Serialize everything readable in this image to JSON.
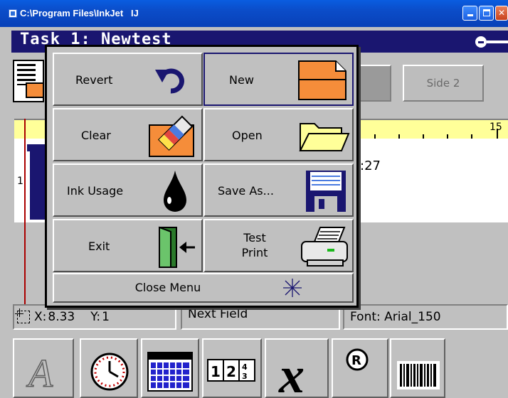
{
  "window": {
    "title": "C:\\Program Files\\InkJet   IJ",
    "buttons": {
      "minimize": "minimize",
      "maximize": "maximize",
      "close": "close"
    }
  },
  "task": {
    "title": "Task 1: Newtest"
  },
  "tabs": {
    "side2": "Side 2"
  },
  "ruler": {
    "label": "15"
  },
  "canvas": {
    "row_number": "1",
    "field_text": ":27"
  },
  "status": {
    "x_label": "X:",
    "x_value": "8.33",
    "y_label": "Y:",
    "y_value": "1",
    "next_field": "Next Field",
    "font": "Font: Arial_150"
  },
  "menu": {
    "items": [
      {
        "label": "Revert",
        "icon": "undo-arrow-icon"
      },
      {
        "label": "New",
        "icon": "new-document-icon"
      },
      {
        "label": "Clear",
        "icon": "eraser-icon"
      },
      {
        "label": "Open",
        "icon": "folder-icon"
      },
      {
        "label": "Ink Usage",
        "icon": "ink-drop-icon"
      },
      {
        "label": "Save As...",
        "icon": "floppy-disk-icon"
      },
      {
        "label": "Exit",
        "icon": "exit-door-icon"
      },
      {
        "label": "Test Print",
        "icon": "printer-icon"
      }
    ],
    "close_label": "Close Menu",
    "close_icon": "sparkle-icon"
  },
  "toolbar": {
    "tools": [
      "text-tool-icon",
      "clock-icon",
      "calendar-icon",
      "counter-icon",
      "shift-code-icon",
      "registered-icon",
      "barcode-icon"
    ],
    "counter_digits": "12",
    "registered_symbol": "®"
  },
  "colors": {
    "title_bar": "#0b4cc8",
    "task_bar": "#1a1670",
    "accent_orange": "#f58d3a",
    "ruler": "#ffff99"
  }
}
